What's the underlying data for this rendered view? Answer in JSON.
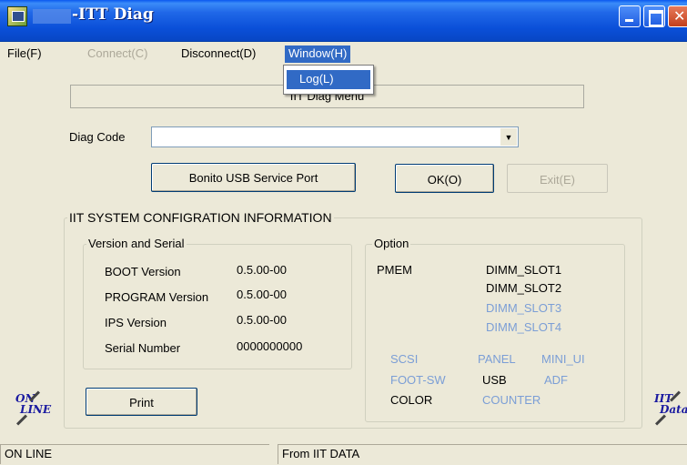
{
  "window": {
    "title": "-ITT Diag",
    "controls": [
      "minimize",
      "maximize",
      "close"
    ]
  },
  "menubar": {
    "items": [
      {
        "label": "File(F)",
        "state": "normal"
      },
      {
        "label": "Connect(C)",
        "state": "disabled"
      },
      {
        "label": "Disconnect(D)",
        "state": "normal"
      },
      {
        "label": "Window(H)",
        "state": "open"
      }
    ],
    "open_menu": {
      "items": [
        {
          "label": "Log(L)",
          "highlighted": true
        }
      ]
    }
  },
  "header": {
    "text": "IIT Diag Menu"
  },
  "diag": {
    "label": "Diag Code",
    "value": ""
  },
  "buttons": {
    "bonito": "Bonito USB Service Port",
    "ok": "OK(O)",
    "exit": "Exit(E)",
    "print": "Print"
  },
  "sysinfo": {
    "title": "IIT SYSTEM CONFIGRATION INFORMATION",
    "version_group": {
      "title": "Version and Serial",
      "rows": [
        {
          "label": "BOOT Version",
          "value": "0.5.00-00"
        },
        {
          "label": "PROGRAM Version",
          "value": "0.5.00-00"
        },
        {
          "label": "IPS Version",
          "value": "0.5.00-00"
        },
        {
          "label": "Serial Number",
          "value": "0000000000"
        }
      ]
    },
    "option_group": {
      "title": "Option",
      "pmem_label": "PMEM",
      "dimm": [
        {
          "label": "DIMM_SLOT1",
          "enabled": true
        },
        {
          "label": "DIMM_SLOT2",
          "enabled": true
        },
        {
          "label": "DIMM_SLOT3",
          "enabled": false
        },
        {
          "label": "DIMM_SLOT4",
          "enabled": false
        }
      ],
      "options": [
        {
          "label": "SCSI",
          "enabled": false
        },
        {
          "label": "PANEL",
          "enabled": false
        },
        {
          "label": "MINI_UI",
          "enabled": false
        },
        {
          "label": "FOOT-SW",
          "enabled": false
        },
        {
          "label": "USB",
          "enabled": true
        },
        {
          "label": "ADF",
          "enabled": false
        },
        {
          "label": "COLOR",
          "enabled": true
        },
        {
          "label": "COUNTER",
          "enabled": false
        }
      ]
    }
  },
  "side_logos": {
    "left": [
      "ON",
      "LINE"
    ],
    "right": [
      "IIT",
      "Data"
    ]
  },
  "statusbar": {
    "left": "ON LINE",
    "right": "From IIT DATA"
  },
  "colors": {
    "titlebar": "#0a4fd8",
    "menu_highlight": "#316ac5",
    "disabled_option": "#7b9ed6",
    "window_bg": "#ece9d8"
  }
}
